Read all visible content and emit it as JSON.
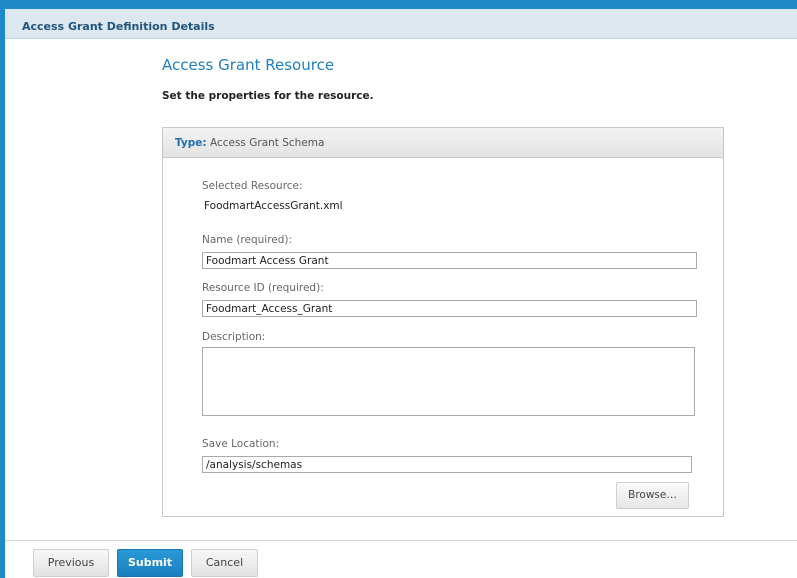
{
  "window": {
    "title": "Access Grant Definition Details"
  },
  "page": {
    "heading": "Access Grant Resource",
    "subheading": "Set the properties for the resource."
  },
  "panel": {
    "type_label": "Type:",
    "type_value": "Access Grant Schema",
    "selected_resource_label": "Selected Resource:",
    "selected_resource_value": "FoodmartAccessGrant.xml",
    "name_label": "Name (required):",
    "name_value": "Foodmart Access Grant",
    "resource_id_label": "Resource ID (required):",
    "resource_id_value": "Foodmart_Access_Grant",
    "description_label": "Description:",
    "description_value": "",
    "save_location_label": "Save Location:",
    "save_location_value": "/analysis/schemas",
    "browse_label": "Browse…"
  },
  "footer": {
    "previous_label": "Previous",
    "submit_label": "Submit",
    "cancel_label": "Cancel"
  },
  "colors": {
    "accent": "#1f8ac8",
    "heading": "#1f7fc0",
    "title_text": "#21547c"
  }
}
